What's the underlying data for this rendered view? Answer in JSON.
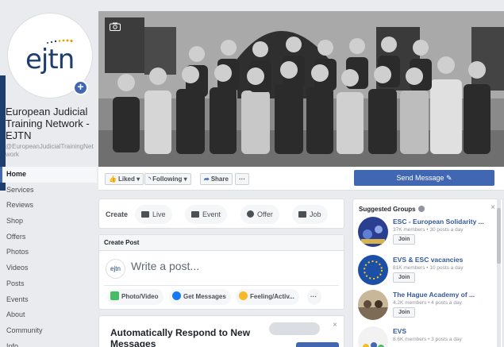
{
  "page": {
    "name": "European Judicial Training Network - EJTN",
    "handle": "@EuropeanJudicialTrainingNetwork",
    "logo_text": "ejtn"
  },
  "nav": [
    "Home",
    "Services",
    "Reviews",
    "Shop",
    "Offers",
    "Photos",
    "Videos",
    "Posts",
    "Events",
    "About",
    "Community",
    "Info"
  ],
  "actions": {
    "liked": "Liked",
    "following": "Following",
    "share": "Share",
    "more": "···",
    "send_message": "Send Message"
  },
  "create": {
    "label": "Create",
    "live": "Live",
    "event": "Event",
    "offer": "Offer",
    "job": "Job"
  },
  "post": {
    "header": "Create Post",
    "placeholder": "Write a post...",
    "avatar_text": "ejtn",
    "photo_video": "Photo/Video",
    "get_messages": "Get Messages",
    "feeling": "Feeling/Activ...",
    "more": "···"
  },
  "autorespond": {
    "title": "Automatically Respond to New Messages",
    "close": "×"
  },
  "suggested": {
    "title": "Suggested Groups",
    "close": "×",
    "groups": [
      {
        "name": "ESC - European Solidarity ...",
        "meta": "37K members • 30 posts a day",
        "join": "Join"
      },
      {
        "name": "EVS & ESC vacancies",
        "meta": "81K members • 10 posts a day",
        "join": "Join"
      },
      {
        "name": "The Hague Academy of ...",
        "meta": "4.2K members • 4 posts a day",
        "join": "Join"
      },
      {
        "name": "EVS",
        "meta": "8.6K members • 3 posts a day",
        "join": ""
      }
    ]
  },
  "colors": {
    "brand_blue": "#4267b2",
    "link_blue": "#385898",
    "accent_navy": "#1d3e6e"
  }
}
